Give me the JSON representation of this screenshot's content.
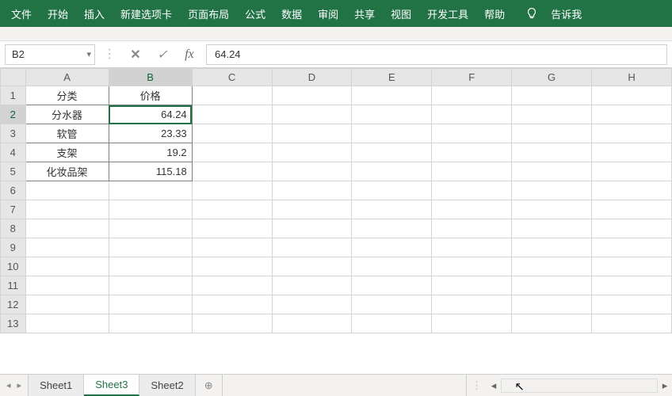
{
  "ribbon": {
    "tabs": [
      "文件",
      "开始",
      "插入",
      "新建选项卡",
      "页面布局",
      "公式",
      "数据",
      "审阅",
      "共享",
      "视图",
      "开发工具",
      "帮助"
    ],
    "tell_me": "告诉我"
  },
  "formula_bar": {
    "name_box": "B2",
    "fx_label": "fx",
    "value": "64.24"
  },
  "grid": {
    "columns": [
      "A",
      "B",
      "C",
      "D",
      "E",
      "F",
      "G",
      "H"
    ],
    "row_count": 13,
    "selected_col": 1,
    "selected_row": 1,
    "data": [
      [
        {
          "v": "分类",
          "a": "c",
          "b": true
        },
        {
          "v": "价格",
          "a": "c",
          "b": true
        }
      ],
      [
        {
          "v": "分水器",
          "a": "c",
          "b": true
        },
        {
          "v": "64.24",
          "a": "r",
          "b": true,
          "sel": true
        }
      ],
      [
        {
          "v": "软管",
          "a": "c",
          "b": true
        },
        {
          "v": "23.33",
          "a": "r",
          "b": true
        }
      ],
      [
        {
          "v": "支架",
          "a": "c",
          "b": true
        },
        {
          "v": "19.2",
          "a": "r",
          "b": true
        }
      ],
      [
        {
          "v": "化妆品架",
          "a": "c",
          "b": true
        },
        {
          "v": "115.18",
          "a": "r",
          "b": true
        }
      ]
    ]
  },
  "sheets": {
    "tabs": [
      "Sheet1",
      "Sheet3",
      "Sheet2"
    ],
    "active": 1,
    "add_label": "+"
  },
  "icons": {
    "bulb": "♡",
    "dropdown": "▾",
    "cancel": "✕",
    "confirm": "✓",
    "nav_first": "◂",
    "nav_prev": "▸",
    "scroll_left": "◂",
    "scroll_right": "▸",
    "add": "⊕"
  }
}
